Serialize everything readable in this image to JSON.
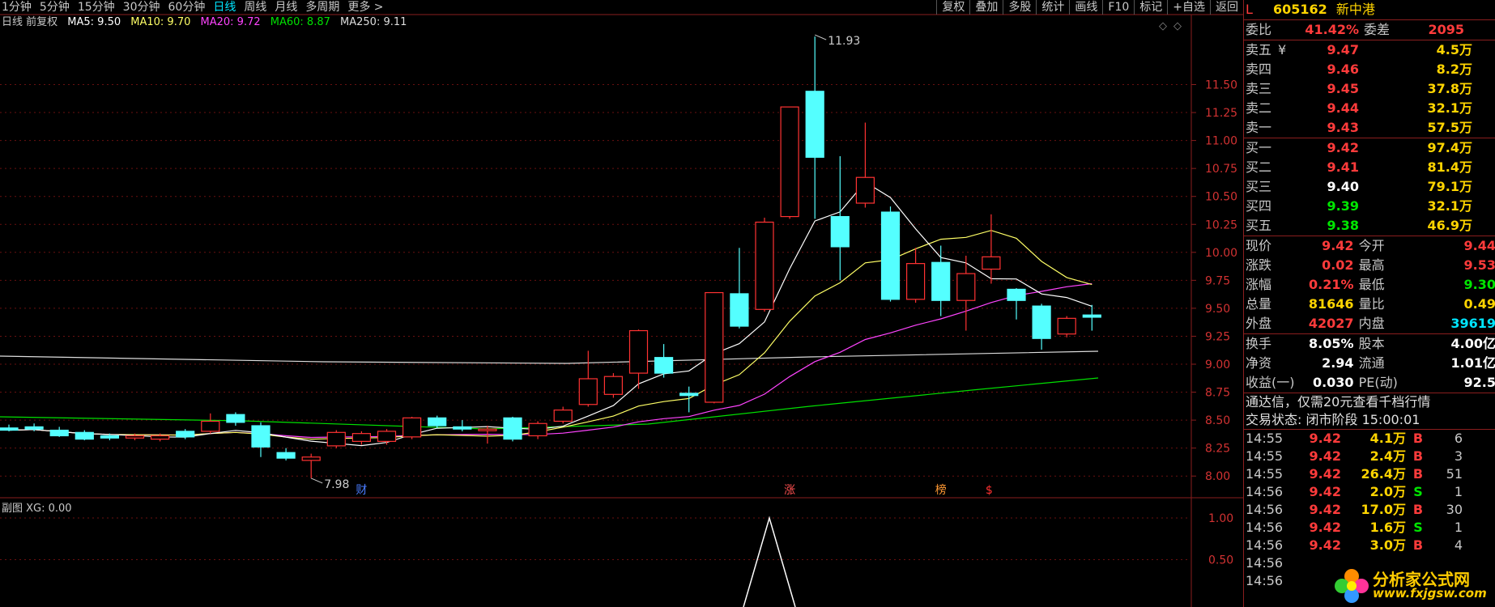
{
  "period_tabs": [
    "1分钟",
    "5分钟",
    "15分钟",
    "30分钟",
    "60分钟",
    "日线",
    "周线",
    "月线",
    "多周期",
    "更多 >"
  ],
  "active_tab": "日线",
  "toolbar": [
    "复权",
    "叠加",
    "多股",
    "统计",
    "画线",
    "F10",
    "标记",
    "+自选",
    "返回"
  ],
  "ma_line": {
    "prefix": "日线 前复权",
    "ma5": "MA5: 9.50",
    "ma10": "MA10: 9.70",
    "ma20": "MA20: 9.72",
    "ma60": "MA60: 8.87",
    "ma250": "MA250: 9.11"
  },
  "colors": {
    "up": "#ff3232",
    "down": "#54ffff",
    "ma5": "#ffffff",
    "ma10": "#ffff66",
    "ma20": "#ff44ff",
    "ma60": "#00e000",
    "ma250": "#dddddd"
  },
  "price_axis": [
    "11.50",
    "11.25",
    "11.00",
    "10.75",
    "10.50",
    "10.25",
    "10.00",
    "9.75",
    "9.50",
    "9.25",
    "9.00",
    "8.75",
    "8.50",
    "8.25",
    "8.00"
  ],
  "annotations": {
    "high": "11.93",
    "low": "7.98",
    "markers": [
      "财",
      "涨",
      "榜",
      "$"
    ]
  },
  "indicator": {
    "title": "副图 XG: 0.00",
    "axis": [
      "1.00",
      "0.50"
    ]
  },
  "candles": [
    [
      8.43,
      8.41,
      8.46,
      8.4
    ],
    [
      8.44,
      8.42,
      8.47,
      8.4
    ],
    [
      8.41,
      8.36,
      8.44,
      8.35
    ],
    [
      8.39,
      8.33,
      8.41,
      8.32
    ],
    [
      8.36,
      8.34,
      8.38,
      8.32
    ],
    [
      8.34,
      8.36,
      8.38,
      8.32
    ],
    [
      8.33,
      8.36,
      8.38,
      8.31
    ],
    [
      8.4,
      8.35,
      8.42,
      8.33
    ],
    [
      8.4,
      8.49,
      8.56,
      8.38
    ],
    [
      8.55,
      8.48,
      8.57,
      8.45
    ],
    [
      8.45,
      8.26,
      8.48,
      8.17
    ],
    [
      8.21,
      8.16,
      8.25,
      8.14
    ],
    [
      8.14,
      8.17,
      8.2,
      7.98
    ],
    [
      8.27,
      8.39,
      8.41,
      8.25
    ],
    [
      8.31,
      8.38,
      8.4,
      8.28
    ],
    [
      8.31,
      8.4,
      8.42,
      8.28
    ],
    [
      8.35,
      8.52,
      8.53,
      8.33
    ],
    [
      8.52,
      8.45,
      8.54,
      8.43
    ],
    [
      8.44,
      8.42,
      8.5,
      8.4
    ],
    [
      8.42,
      8.42,
      8.45,
      8.29
    ],
    [
      8.52,
      8.33,
      8.53,
      8.31
    ],
    [
      8.36,
      8.47,
      8.49,
      8.33
    ],
    [
      8.49,
      8.59,
      8.62,
      8.47
    ],
    [
      8.64,
      8.87,
      9.12,
      8.62
    ],
    [
      8.73,
      8.89,
      8.92,
      8.7
    ],
    [
      8.92,
      9.3,
      9.31,
      8.78
    ],
    [
      9.06,
      8.92,
      9.18,
      8.88
    ],
    [
      8.74,
      8.72,
      8.8,
      8.57
    ],
    [
      8.66,
      9.64,
      9.64,
      8.65
    ],
    [
      9.63,
      9.34,
      10.04,
      9.32
    ],
    [
      9.49,
      10.27,
      10.31,
      9.47
    ],
    [
      10.32,
      11.3,
      11.3,
      10.3
    ],
    [
      11.44,
      10.85,
      11.93,
      10.3
    ],
    [
      10.32,
      10.05,
      10.86,
      9.75
    ],
    [
      10.44,
      10.67,
      11.16,
      10.4
    ],
    [
      10.36,
      9.58,
      10.41,
      9.56
    ],
    [
      9.58,
      9.9,
      10.04,
      9.55
    ],
    [
      9.91,
      9.57,
      10.06,
      9.43
    ],
    [
      9.57,
      9.81,
      9.97,
      9.3
    ],
    [
      9.85,
      9.96,
      10.34,
      9.72
    ],
    [
      9.67,
      9.57,
      9.68,
      9.4
    ],
    [
      9.52,
      9.23,
      9.54,
      9.13
    ],
    [
      9.27,
      9.41,
      9.43,
      9.24
    ],
    [
      9.44,
      9.42,
      9.53,
      9.3
    ]
  ],
  "stock": {
    "code": "605162",
    "name": "新中港",
    "flag": "L"
  },
  "order_ratio": {
    "label1": "委比",
    "ratio": "41.42%",
    "label2": "委差",
    "diff": "2095"
  },
  "asks": [
    {
      "label": "卖五",
      "sym": "¥",
      "price": "9.47",
      "vol": "4.5万"
    },
    {
      "label": "卖四",
      "sym": "",
      "price": "9.46",
      "vol": "8.2万"
    },
    {
      "label": "卖三",
      "sym": "",
      "price": "9.45",
      "vol": "37.8万"
    },
    {
      "label": "卖二",
      "sym": "",
      "price": "9.44",
      "vol": "32.1万"
    },
    {
      "label": "卖一",
      "sym": "",
      "price": "9.43",
      "vol": "57.5万"
    }
  ],
  "bids": [
    {
      "label": "买一",
      "price": "9.42",
      "vol": "97.4万"
    },
    {
      "label": "买二",
      "price": "9.41",
      "vol": "81.4万"
    },
    {
      "label": "买三",
      "price": "9.40",
      "vol": "79.1万"
    },
    {
      "label": "买四",
      "price": "9.39",
      "vol": "32.1万"
    },
    {
      "label": "买五",
      "price": "9.38",
      "vol": "46.9万"
    }
  ],
  "quote": [
    {
      "l1": "现价",
      "v1": "9.42",
      "l2": "今开",
      "v2": "9.44"
    },
    {
      "l1": "涨跌",
      "v1": "0.02",
      "l2": "最高",
      "v2": "9.53"
    },
    {
      "l1": "涨幅",
      "v1": "0.21%",
      "l2": "最低",
      "v2": "9.30"
    },
    {
      "l1": "总量",
      "v1": "81646",
      "l2": "量比",
      "v2": "0.49"
    },
    {
      "l1": "外盘",
      "v1": "42027",
      "l2": "内盘",
      "v2": "39619"
    }
  ],
  "fundamentals": [
    {
      "l1": "换手",
      "v1": "8.05%",
      "l2": "股本",
      "v2": "4.00亿"
    },
    {
      "l1": "净资",
      "v1": "2.94",
      "l2": "流通",
      "v2": "1.01亿"
    },
    {
      "l1": "收益(一)",
      "v1": "0.030",
      "l2": "PE(动)",
      "v2": "92.5"
    }
  ],
  "ad_text": "通达信，仅需20元查看千档行情",
  "trade_status": "交易状态: 闭市阶段 15:00:01",
  "ticks": [
    {
      "time": "14:55",
      "price": "9.42",
      "vol": "4.1万",
      "side": "B",
      "n": "6"
    },
    {
      "time": "14:55",
      "price": "9.42",
      "vol": "2.4万",
      "side": "B",
      "n": "3"
    },
    {
      "time": "14:55",
      "price": "9.42",
      "vol": "26.4万",
      "side": "B",
      "n": "51"
    },
    {
      "time": "14:56",
      "price": "9.42",
      "vol": "2.0万",
      "side": "S",
      "n": "1"
    },
    {
      "time": "14:56",
      "price": "9.42",
      "vol": "17.0万",
      "side": "B",
      "n": "30"
    },
    {
      "time": "14:56",
      "price": "9.42",
      "vol": "1.6万",
      "side": "S",
      "n": "1"
    },
    {
      "time": "14:56",
      "price": "9.42",
      "vol": "3.0万",
      "side": "B",
      "n": "4"
    },
    {
      "time": "14:56",
      "price": "",
      "vol": "",
      "side": "",
      "n": ""
    },
    {
      "time": "14:56",
      "price": "",
      "vol": "",
      "side": "",
      "n": ""
    }
  ],
  "watermark": {
    "title": "分析家公式网",
    "url": "www.fxjgsw.com"
  }
}
